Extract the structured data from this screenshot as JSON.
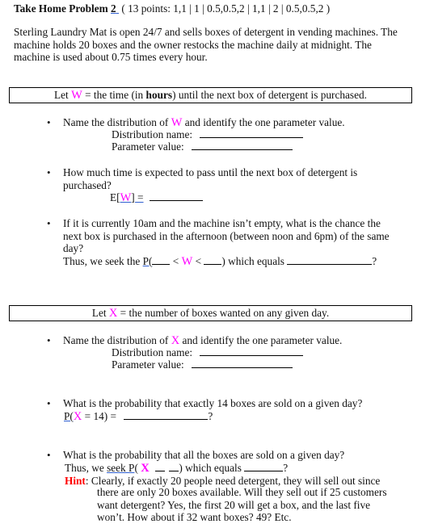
{
  "title": {
    "bold": "Take Home Problem",
    "number": "2",
    "rest": " ( 13 points: 1,1 | 1 | 0.5,0.5,2 | 1,1 | 2 | 0.5,0.5,2 )"
  },
  "intro": [
    "Sterling Laundry Mat is open 24/7 and sells boxes of detergent in vending machines.  The",
    "machine holds 20 boxes and the owner restocks the machine daily at midnight.  The",
    "machine is used about 0.75 times every hour."
  ],
  "section_w": {
    "box": {
      "pre": "Let ",
      "var": "W",
      "mid": " = the time (in ",
      "bold": "hours",
      "post": ") until the next box of detergent is purchased."
    },
    "q1": {
      "pre": "Name the distribution of ",
      "var": "W",
      "post": " and identify the one parameter value.",
      "dist_label": "Distribution name:",
      "param_label": "Parameter value:"
    },
    "q2": {
      "line1": "How much time is expected to pass until the next box of detergent is",
      "line2": "purchased?",
      "expect_pre": "E[",
      "expect_var": "W",
      "expect_post": "]  ="
    },
    "q3": {
      "line1": "If it is currently 10am and the machine isn’t empty, what is the chance the",
      "line2": "next box is purchased in the afternoon (between noon and 6pm) of the same",
      "line3": "day?",
      "seek_pre": "Thus, we seek the ",
      "seek_p": "P(",
      "seek_lt1": " < ",
      "seek_var": "W",
      "seek_lt2": " < ",
      "seek_post": ") which equals ",
      "qmark": "?"
    }
  },
  "section_x": {
    "box": {
      "pre": "Let ",
      "var": "X",
      "post": " = the number of boxes wanted on any given day."
    },
    "q1": {
      "pre": "Name the distribution of ",
      "var": "X",
      "post": " and identify the one parameter value.",
      "dist_label": "Distribution name:",
      "param_label": "Parameter value:"
    },
    "q2": {
      "line1": "What is the probability that exactly 14 boxes are sold on a given day?",
      "p_pre": "P(",
      "p_var": "X",
      "p_post": " = 14)  =",
      "qmark": "?"
    },
    "q3": {
      "line1": "What is the probability that all the boxes are sold on a given day?",
      "seek_pre": "Thus, we ",
      "seek_word": "seek  P",
      "seek_paren": "( ",
      "seek_var": "X",
      "seek_post": ")  which equals ",
      "qmark": "?",
      "hint_label": "Hint",
      "hint_line1": ":  Clearly, if exactly 20 people need detergent, they will sell out since",
      "hint_line2": "there are only 20 boxes available.  Will they sell out if 25 customers",
      "hint_line3": "want detergent?  Yes, the first 20 will get a box, and the last five",
      "hint_line4": "won’t.  How about if 32 want boxes?  49?  Etc."
    }
  },
  "bullet_glyph": "•",
  "colors": {
    "variable": "#ff00ff",
    "hint": "#ff0000",
    "spellcheck": "#2f5fd0"
  }
}
